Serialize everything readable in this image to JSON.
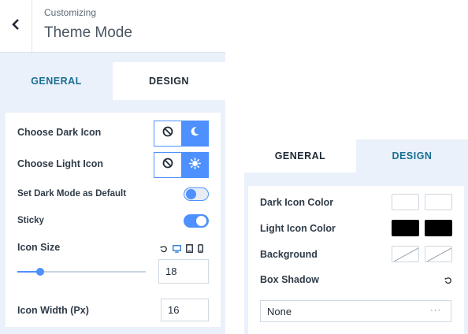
{
  "header": {
    "breadcrumb": "Customizing",
    "title": "Theme Mode",
    "back_icon": "chevron-left-icon"
  },
  "left_panel": {
    "tabs": [
      {
        "label": "GENERAL",
        "active": true
      },
      {
        "label": "DESIGN",
        "active": false
      }
    ],
    "choose_dark_icon": {
      "label": "Choose Dark Icon",
      "options": [
        "no-icon",
        "moon-icon"
      ],
      "selected": "moon-icon"
    },
    "choose_light_icon": {
      "label": "Choose Light Icon",
      "options": [
        "no-icon",
        "sun-icon"
      ],
      "selected": "sun-icon"
    },
    "dark_default": {
      "label": "Set Dark Mode as Default",
      "on": false
    },
    "sticky": {
      "label": "Sticky",
      "on": true
    },
    "icon_size": {
      "label": "Icon Size",
      "value": "18",
      "slider_fraction": 0.18,
      "devices": [
        "reset-icon",
        "desktop-icon",
        "tablet-icon",
        "mobile-icon"
      ]
    },
    "icon_width": {
      "label": "Icon Width (Px)",
      "value": "16"
    }
  },
  "right_panel": {
    "tabs": [
      {
        "label": "GENERAL",
        "active": false
      },
      {
        "label": "DESIGN",
        "active": true
      }
    ],
    "dark_icon_color": {
      "label": "Dark Icon Color",
      "colors": [
        "#ffffff",
        "#ffffff"
      ]
    },
    "light_icon_color": {
      "label": "Light Icon Color",
      "colors": [
        "#000000",
        "#000000"
      ]
    },
    "background": {
      "label": "Background",
      "colors": [
        "transparent",
        "transparent"
      ]
    },
    "box_shadow": {
      "label": "Box Shadow",
      "value": "None",
      "dots": "···"
    }
  },
  "colors": {
    "accent": "#4d90fe",
    "tab_active_text": "#1a6e93",
    "panel_bg": "#eaf1fb"
  }
}
